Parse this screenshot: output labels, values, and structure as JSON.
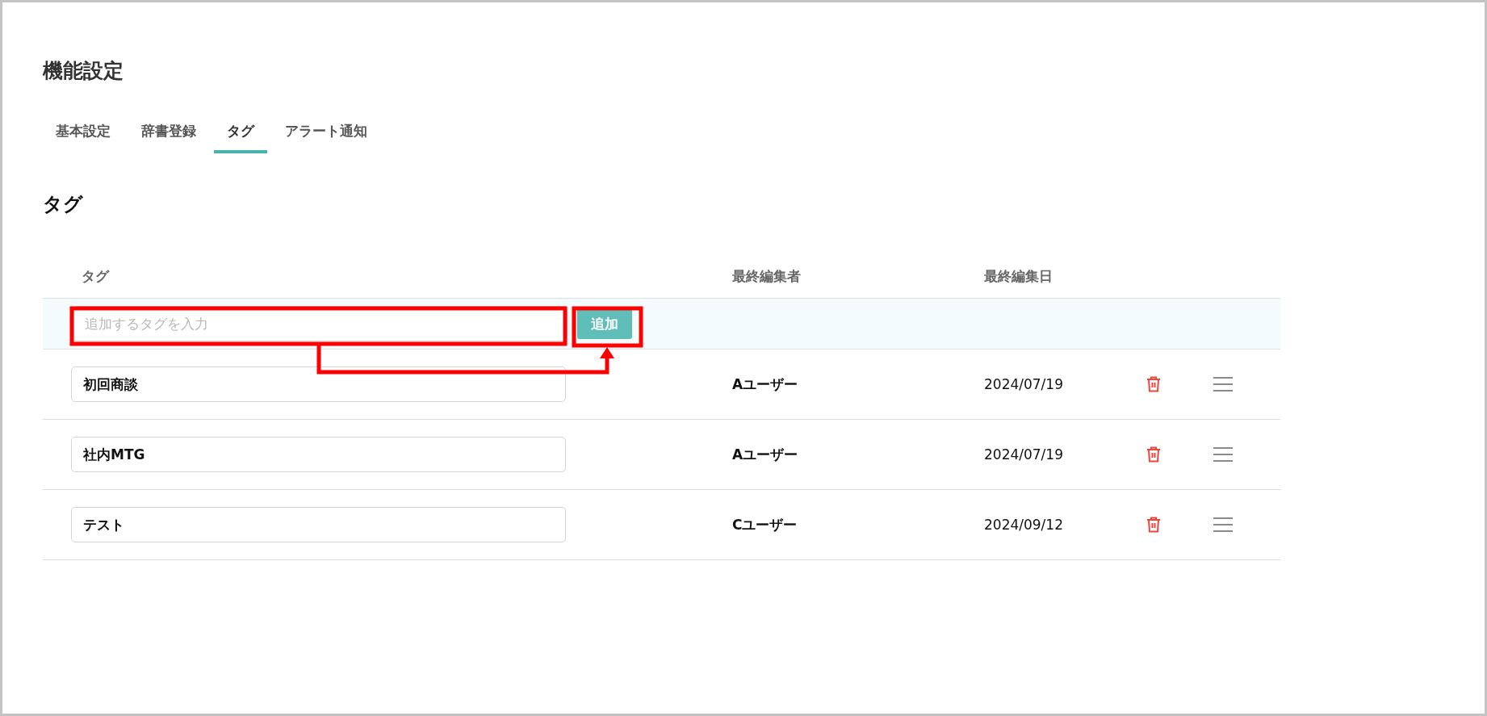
{
  "page_title": "機能設定",
  "tabs": [
    {
      "label": "基本設定",
      "selected": false
    },
    {
      "label": "辞書登録",
      "selected": false
    },
    {
      "label": "タグ",
      "selected": true
    },
    {
      "label": "アラート通知",
      "selected": false
    }
  ],
  "section_title": "タグ",
  "table": {
    "columns": [
      "タグ",
      "最終編集者",
      "最終編集日"
    ],
    "new_tag": {
      "placeholder": "追加するタグを入力",
      "button": "追加"
    },
    "rows": [
      {
        "tag": "初回商談",
        "editor": "Aユーザー",
        "date": "2024/07/19"
      },
      {
        "tag": "社内MTG",
        "editor": "Aユーザー",
        "date": "2024/07/19"
      },
      {
        "tag": "テスト",
        "editor": "Cユーザー",
        "date": "2024/09/12"
      }
    ]
  }
}
